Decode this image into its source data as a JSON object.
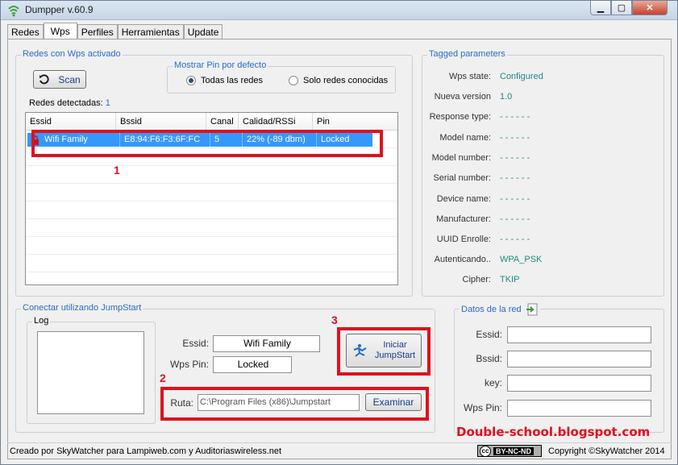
{
  "window": {
    "title": "Dumpper v.60.9",
    "controls": {
      "minimize": "▁",
      "maximize": "▢",
      "close": "✕"
    }
  },
  "tabs": [
    "Redes",
    "Wps",
    "Perfiles",
    "Herramientas",
    "Update"
  ],
  "wps_group": {
    "label": "Redes con Wps activado",
    "scan_button": "Scan",
    "pin_group": {
      "label": "Mostrar Pin por defecto",
      "options": [
        "Todas las redes",
        "Solo redes conocidas"
      ],
      "selected": "Todas las redes"
    },
    "detected_label": "Redes detectadas:",
    "detected_count": "1",
    "columns": [
      "Essid",
      "Bssid",
      "Canal",
      "Calidad/RSSi",
      "Pin"
    ],
    "rows": [
      {
        "essid": "Wifi Family",
        "bssid": "E8:94:F6:F3:6F:FC",
        "canal": "5",
        "calidad": "22% (-89 dbm)",
        "pin": "Locked"
      }
    ]
  },
  "tagged": {
    "label": "Tagged parameters",
    "params": [
      {
        "key": "Wps state:",
        "value": "Configured"
      },
      {
        "key": "Nueva version",
        "value": "1.0"
      },
      {
        "key": "Response type:",
        "value": "- - - - - -"
      },
      {
        "key": "Model name:",
        "value": "- - - - - -"
      },
      {
        "key": "Model number:",
        "value": "- - - - - -"
      },
      {
        "key": "Serial number:",
        "value": "- - - - - -"
      },
      {
        "key": "Device name:",
        "value": "- - - - - -"
      },
      {
        "key": "Manufacturer:",
        "value": "- - - - - -"
      },
      {
        "key": "UUID Enrolle:",
        "value": "- - - - - -"
      },
      {
        "key": "Autenticando..",
        "value": "WPA_PSK"
      },
      {
        "key": "Cipher:",
        "value": "TKIP"
      }
    ]
  },
  "jumpstart": {
    "label": "Conectar utilizando JumpStart",
    "log_label": "Log",
    "essid_label": "Essid:",
    "essid_value": "Wifi Family",
    "pin_label": "Wps Pin:",
    "pin_value": "Locked",
    "start_button_line1": "Iniciar",
    "start_button_line2": "JumpStart",
    "ruta_label": "Ruta:",
    "ruta_value": "C:\\Program Files (x86)\\Jumpstart",
    "browse_button": "Examinar"
  },
  "datos": {
    "label": "Datos de la red",
    "fields": [
      "Essid:",
      "Bssid:",
      "key:",
      "Wps Pin:"
    ]
  },
  "annotations": [
    "1",
    "2",
    "3"
  ],
  "watermark": "Double-school.blogspot.com",
  "status": {
    "left": "Creado por SkyWatcher para Lampiweb.com y Auditoriaswireless.net",
    "license": "BY-NC-ND",
    "right": "Copyright ©SkyWatcher 2014"
  },
  "colors": {
    "accent_label": "#2b6cc4",
    "selection": "#3399ff",
    "param_value": "#1f8a82",
    "annotation": "#e0101f"
  }
}
